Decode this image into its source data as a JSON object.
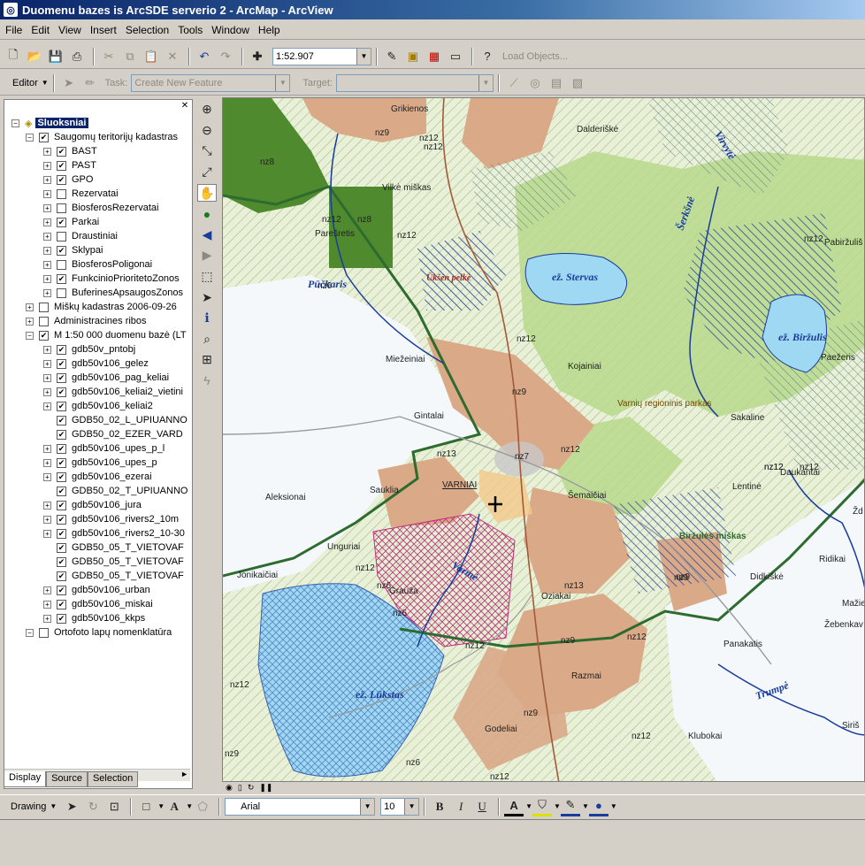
{
  "window": {
    "title": "Duomenu bazes is ArcSDE serverio 2 - ArcMap - ArcView"
  },
  "menu": [
    "File",
    "Edit",
    "View",
    "Insert",
    "Selection",
    "Tools",
    "Window",
    "Help"
  ],
  "standard_toolbar": {
    "scale": "1:52.907",
    "load_objects": "Load Objects..."
  },
  "editor_toolbar": {
    "editor": "Editor",
    "task_label": "Task:",
    "task_value": "Create New Feature",
    "target_label": "Target:"
  },
  "toc": {
    "root": "Sluoksniai",
    "rows": [
      {
        "label": "Saugomų teritorijų kadastras",
        "level": 1,
        "expander": "-",
        "checked": true
      },
      {
        "label": "BAST",
        "level": 2,
        "expander": "+",
        "checked": true
      },
      {
        "label": "PAST",
        "level": 2,
        "expander": "+",
        "checked": true
      },
      {
        "label": "GPO",
        "level": 2,
        "expander": "+",
        "checked": true
      },
      {
        "label": "Rezervatai",
        "level": 2,
        "expander": "+",
        "checked": false
      },
      {
        "label": "BiosferosRezervatai",
        "level": 2,
        "expander": "+",
        "checked": false
      },
      {
        "label": "Parkai",
        "level": 2,
        "expander": "+",
        "checked": true
      },
      {
        "label": "Draustiniai",
        "level": 2,
        "expander": "+",
        "checked": false
      },
      {
        "label": "Sklypai",
        "level": 2,
        "expander": "+",
        "checked": true
      },
      {
        "label": "BiosferosPoligonai",
        "level": 2,
        "expander": "+",
        "checked": false
      },
      {
        "label": "FunkcinioPrioritetoZonos",
        "level": 2,
        "expander": "+",
        "checked": true
      },
      {
        "label": "BuferinesApsaugosZonos",
        "level": 2,
        "expander": "+",
        "checked": false
      },
      {
        "label": "Miškų kadastras 2006-09-26",
        "level": 1,
        "expander": "+",
        "checked": false
      },
      {
        "label": "Administracines ribos",
        "level": 1,
        "expander": "+",
        "checked": false
      },
      {
        "label": "M 1:50 000 duomenu bazė (LT",
        "level": 1,
        "expander": "-",
        "checked": true
      },
      {
        "label": "gdb50v_pntobj",
        "level": 2,
        "expander": "+",
        "checked": true
      },
      {
        "label": "gdb50v106_gelez",
        "level": 2,
        "expander": "+",
        "checked": true
      },
      {
        "label": "gdb50v106_pag_keliai",
        "level": 2,
        "expander": "+",
        "checked": true
      },
      {
        "label": "gdb50v106_keliai2_vietini",
        "level": 2,
        "expander": "+",
        "checked": true
      },
      {
        "label": "gdb50v106_keliai2",
        "level": 2,
        "expander": "+",
        "checked": true
      },
      {
        "label": "GDB50_02_L_UPIUANNO",
        "level": 2,
        "expander": "",
        "checked": true
      },
      {
        "label": "GDB50_02_EZER_VARD",
        "level": 2,
        "expander": "",
        "checked": true
      },
      {
        "label": "gdb50v106_upes_p_l",
        "level": 2,
        "expander": "+",
        "checked": true
      },
      {
        "label": "gdb50v106_upes_p",
        "level": 2,
        "expander": "+",
        "checked": true
      },
      {
        "label": "gdb50v106_ezerai",
        "level": 2,
        "expander": "+",
        "checked": true
      },
      {
        "label": "GDB50_02_T_UPIUANNO",
        "level": 2,
        "expander": "",
        "checked": true
      },
      {
        "label": "gdb50v106_jura",
        "level": 2,
        "expander": "+",
        "checked": true
      },
      {
        "label": "gdb50v106_rivers2_10m",
        "level": 2,
        "expander": "+",
        "checked": true
      },
      {
        "label": "gdb50v106_rivers2_10-30",
        "level": 2,
        "expander": "+",
        "checked": true
      },
      {
        "label": "GDB50_05_T_VIETOVAF",
        "level": 2,
        "expander": "",
        "checked": true
      },
      {
        "label": "GDB50_05_T_VIETOVAF",
        "level": 2,
        "expander": "",
        "checked": true
      },
      {
        "label": "GDB50_05_T_VIETOVAF",
        "level": 2,
        "expander": "",
        "checked": true
      },
      {
        "label": "gdb50v106_urban",
        "level": 2,
        "expander": "+",
        "checked": true
      },
      {
        "label": "gdb50v106_miskai",
        "level": 2,
        "expander": "+",
        "checked": true
      },
      {
        "label": "gdb50v106_kkps",
        "level": 2,
        "expander": "+",
        "checked": true
      },
      {
        "label": "Ortofoto lapų nomenklatūra",
        "level": 1,
        "expander": "-",
        "checked": false
      }
    ]
  },
  "toc_tabs": [
    "Display",
    "Source",
    "Selection"
  ],
  "map": {
    "labels": {
      "grikienos": "Grikienos",
      "dalderiske": "Dalderiškė",
      "vilke": "Vilkė miškas",
      "paresretis": "Parešretis",
      "pirkeriai": "Pabiržuliš",
      "miezeiniai": "Miežeiniai",
      "gintalai": "Gintalai",
      "kojainiai": "Kojainiai",
      "park": "Varnių regioninis parkas",
      "sakaline": "Sakaline",
      "paezeris": "Paežeris",
      "varniai": "VARNIAI",
      "saukliai": "Sauklia",
      "semaiciai": "Šemaičiai",
      "lentine": "Lentinė",
      "daukantai": "Daukantai",
      "aleksionai": "Aleksionai",
      "ungurai": "Unguriai",
      "jonikaiciai": "Jonikaičiai",
      "grauza": "Grauža",
      "oziakai": "Oziakai",
      "razmai": "Razmai",
      "godeliai": "Godeliai",
      "ridikai": "Ridikai",
      "didkiske": "Didkiškė",
      "maziai": "Mažie",
      "zebenkava": "Žebenkav",
      "panakatis": "Panakatis",
      "klubokai": "Klubokai",
      "siriai": "Siriš",
      "forest": "Biržulės miškas",
      "zd": "Žd"
    },
    "water": {
      "sterva": "ež. Stervas",
      "birzulis": "ež. Biržulis",
      "lukstas": "ež. Lūkstas",
      "varvina": "Varmė",
      "trumpe": "Trumpė",
      "virvyte": "Virvytė",
      "seilava": "Šerkšnė",
      "pabezeris": "Pūčkaris",
      "uzkelio": "Ūkšėn pelkė"
    },
    "zones": [
      "nz8",
      "nz9",
      "nz12",
      "nz8",
      "nz12",
      "nz12",
      "nz6",
      "nz12",
      "nz9",
      "nz13",
      "nz7",
      "nz12",
      "nz12",
      "nz9",
      "nz12",
      "nz6",
      "nz13",
      "nz9",
      "nz12",
      "nz12",
      "nz12",
      "nz9",
      "nz12",
      "nz6",
      "nz12",
      "nz9",
      "nz6",
      "nz12",
      "nz12",
      "nz12",
      "nz12",
      "nz9"
    ]
  },
  "drawing_toolbar": {
    "drawing": "Drawing",
    "font": "Arial",
    "size": "10"
  },
  "colors": {
    "title_start": "#0a246a",
    "title_end": "#a6caf0",
    "water": "#9fd8f2",
    "forest_dark": "#4f8a2f",
    "forest_light": "#b7d98b",
    "protected": "#d9a988",
    "boundary": "#2e6b2e"
  }
}
